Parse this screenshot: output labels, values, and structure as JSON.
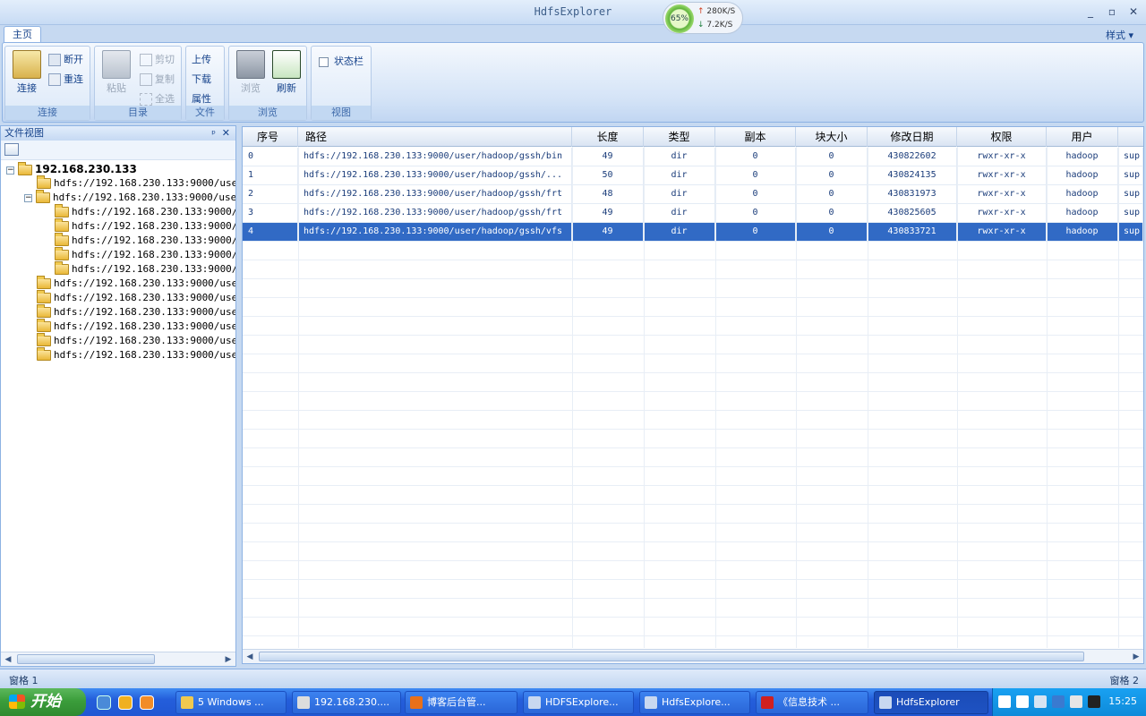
{
  "window": {
    "title": "HdfsExplorer",
    "controls": [
      "_",
      "▫",
      "✕"
    ]
  },
  "speed": {
    "percent": "65%",
    "up": "280K/S",
    "down": "7.2K/S"
  },
  "ribbon": {
    "tab": "主页",
    "style_menu": "样式 ▾",
    "groups": {
      "connect": {
        "label": "连接",
        "connect_btn": "连接",
        "disconnect": "断开",
        "reconnect": "重连"
      },
      "dir": {
        "label": "目录",
        "paste": "粘贴",
        "cut": "剪切",
        "copy": "复制",
        "selectall": "全选"
      },
      "file": {
        "label": "文件",
        "upload": "上传",
        "download": "下载",
        "props": "属性"
      },
      "browse": {
        "label": "浏览",
        "browse_btn": "浏览",
        "refresh": "刷新"
      },
      "view": {
        "label": "视图",
        "statusbar": "状态栏"
      }
    }
  },
  "leftpane": {
    "title": "文件视图",
    "pin": "ᵖ",
    "close": "✕",
    "root": "192.168.230.133",
    "nodes": [
      "hdfs://192.168.230.133:9000/user/",
      "hdfs://192.168.230.133:9000/user/",
      "hdfs://192.168.230.133:9000/us",
      "hdfs://192.168.230.133:9000/us",
      "hdfs://192.168.230.133:9000/us",
      "hdfs://192.168.230.133:9000/us",
      "hdfs://192.168.230.133:9000/us",
      "hdfs://192.168.230.133:9000/user/",
      "hdfs://192.168.230.133:9000/user/",
      "hdfs://192.168.230.133:9000/user/",
      "hdfs://192.168.230.133:9000/user/",
      "hdfs://192.168.230.133:9000/user/",
      "hdfs://192.168.230.133:9000/user/"
    ]
  },
  "grid": {
    "headers": [
      "序号",
      "路径",
      "长度",
      "类型",
      "副本",
      "块大小",
      "修改日期",
      "权限",
      "用户",
      ""
    ],
    "rows": [
      [
        "0",
        "hdfs://192.168.230.133:9000/user/hadoop/gssh/bin",
        "49",
        "dir",
        "0",
        "0",
        "430822602",
        "rwxr-xr-x",
        "hadoop",
        "sup"
      ],
      [
        "1",
        "hdfs://192.168.230.133:9000/user/hadoop/gssh/...",
        "50",
        "dir",
        "0",
        "0",
        "430824135",
        "rwxr-xr-x",
        "hadoop",
        "sup"
      ],
      [
        "2",
        "hdfs://192.168.230.133:9000/user/hadoop/gssh/frt",
        "48",
        "dir",
        "0",
        "0",
        "430831973",
        "rwxr-xr-x",
        "hadoop",
        "sup"
      ],
      [
        "3",
        "hdfs://192.168.230.133:9000/user/hadoop/gssh/frt",
        "49",
        "dir",
        "0",
        "0",
        "430825605",
        "rwxr-xr-x",
        "hadoop",
        "sup"
      ],
      [
        "4",
        "hdfs://192.168.230.133:9000/user/hadoop/gssh/vfs",
        "49",
        "dir",
        "0",
        "0",
        "430833721",
        "rwxr-xr-x",
        "hadoop",
        "sup"
      ]
    ],
    "selected_row": 4
  },
  "status": {
    "left": "窗格 1",
    "right": "窗格 2"
  },
  "taskbar": {
    "start": "开始",
    "buttons": [
      "5 Windows ...",
      "192.168.230....",
      "博客后台管...",
      "HDFSExplore...",
      "HdfsExplore...",
      "《信息技术 ...",
      "HdfsExplorer"
    ],
    "clock": "15:25"
  },
  "colors": {
    "accent": "#316ac5",
    "ribbon_border": "#8db2e3",
    "taskbar": "#245edb"
  }
}
